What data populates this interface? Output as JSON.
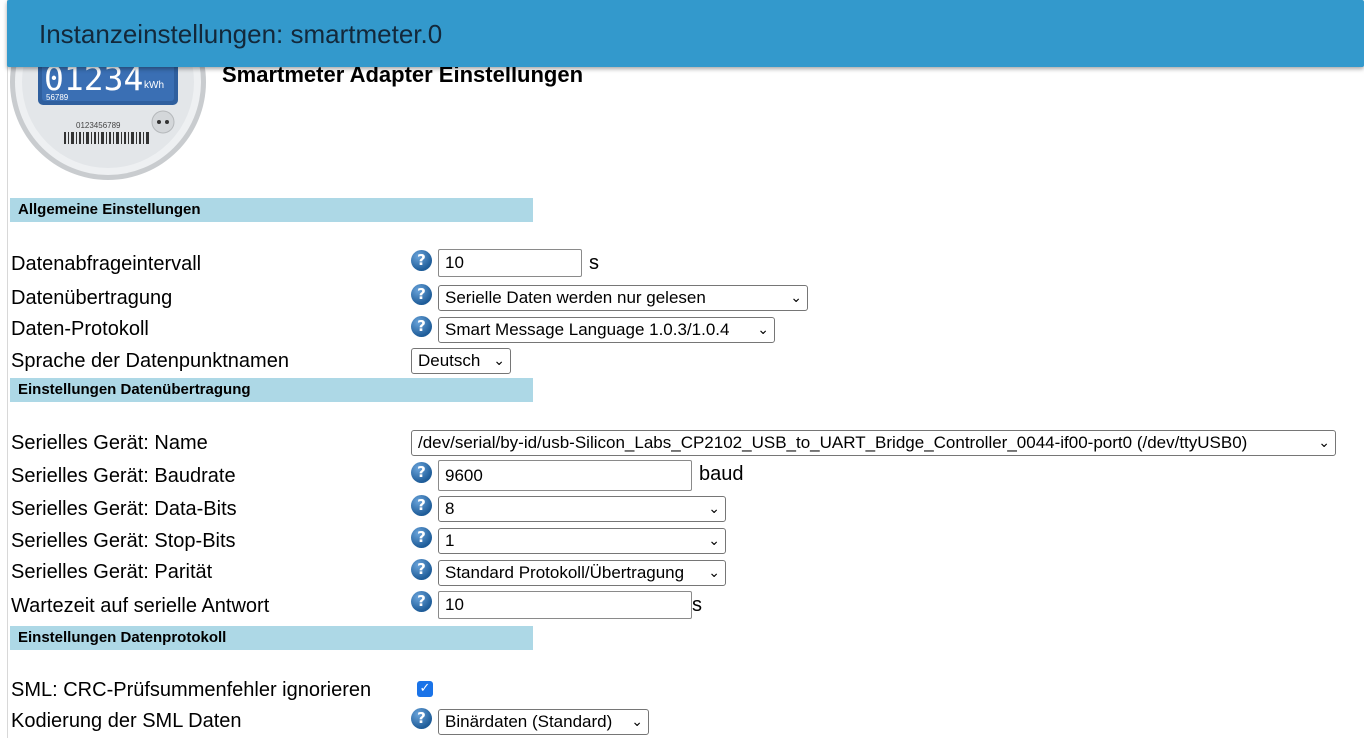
{
  "window": {
    "title": "Instanzeinstellungen: smartmeter.0"
  },
  "header": {
    "adapter_title": "Smartmeter Adapter Einstellungen",
    "logo": {
      "display": "01234",
      "unit": "kWh",
      "sub": "56789",
      "serial": "0123456789"
    }
  },
  "sections": {
    "general": "Allgemeine Einstellungen",
    "transfer": "Einstellungen Datenübertragung",
    "protocol": "Einstellungen Datenprotokoll"
  },
  "fields": {
    "interval": {
      "label": "Datenabfrageintervall",
      "value": "10",
      "unit": "s"
    },
    "transfer": {
      "label": "Datenübertragung",
      "value": "Serielle Daten werden nur gelesen"
    },
    "protocol": {
      "label": "Daten-Protokoll",
      "value": "Smart Message Language 1.0.3/1.0.4"
    },
    "language": {
      "label": "Sprache der Datenpunktnamen",
      "value": "Deutsch"
    },
    "serial_name": {
      "label": "Serielles Gerät: Name",
      "value": "/dev/serial/by-id/usb-Silicon_Labs_CP2102_USB_to_UART_Bridge_Controller_0044-if00-port0 (/dev/ttyUSB0)"
    },
    "baudrate": {
      "label": "Serielles Gerät: Baudrate",
      "value": "9600",
      "unit": "baud"
    },
    "databits": {
      "label": "Serielles Gerät: Data-Bits",
      "value": "8"
    },
    "stopbits": {
      "label": "Serielles Gerät: Stop-Bits",
      "value": "1"
    },
    "parity": {
      "label": "Serielles Gerät: Parität",
      "value": "Standard Protokoll/Übertragung"
    },
    "timeout": {
      "label": "Wartezeit auf serielle Antwort",
      "value": "10",
      "unit": "s"
    },
    "crc": {
      "label": "SML: CRC-Prüfsummenfehler ignorieren",
      "checked": true
    },
    "encoding": {
      "label": "Kodierung der SML Daten",
      "value": "Binärdaten (Standard)"
    }
  },
  "icons": {
    "help": "help-icon",
    "dropdown": "chevron-down-icon",
    "check": "checkmark-icon"
  },
  "colors": {
    "titlebar": "#3399cc",
    "section": "#add8e6",
    "checkbox": "#1a73e8"
  }
}
